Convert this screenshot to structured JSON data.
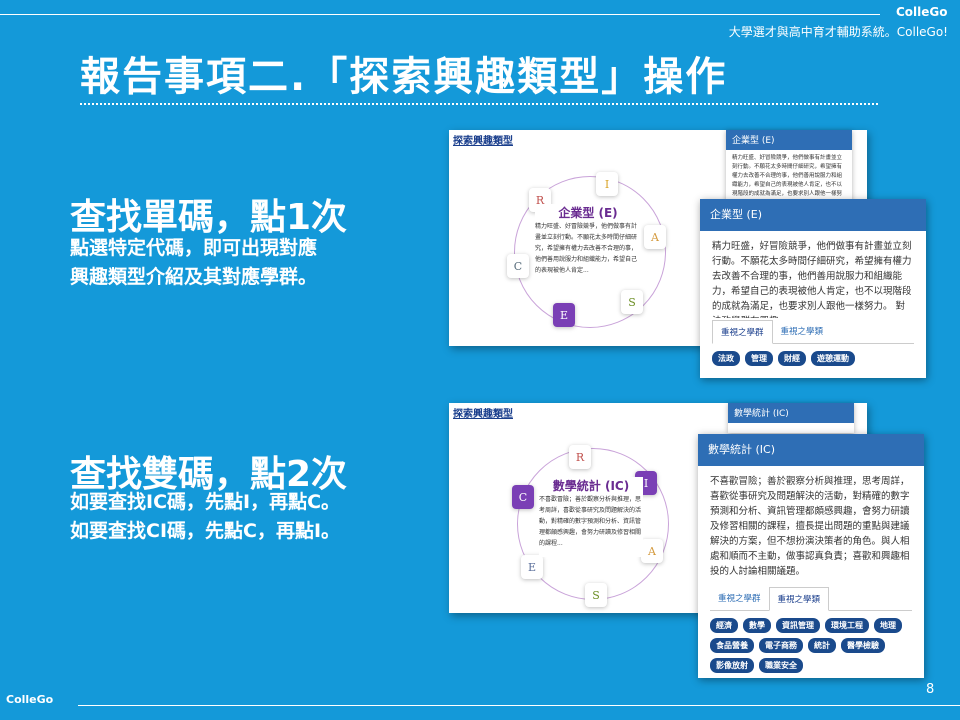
{
  "header": {
    "brand": "ColleGo",
    "subtitle": "大學選才與高中育才輔助系統。ColleGo!",
    "title": "報告事項二.「探索興趣類型」操作"
  },
  "section1": {
    "heading": "查找單碼，點1次",
    "line1": "點選特定代碼，即可出現對應",
    "line2": "興趣類型介紹及其對應學群。"
  },
  "section2": {
    "heading": "查找雙碼，點2次",
    "line1": "如要查找IC碼，先點I，再點C。",
    "line2": "如要查找CI碼，先點C，再點I。"
  },
  "shot1": {
    "tab": "探索興趣類型",
    "nodes": {
      "r": "R",
      "i": "I",
      "a": "A",
      "s": "S",
      "e": "E",
      "c": "C"
    },
    "center_title": "企業型 (E)",
    "center_text": "精力旺盛、好冒險競爭，他們做事有計畫並立刻行動。不願花太多時間仔細研究，希望擁有權力去改善不合理的事，他們善用說服力和組織能力，希望自己的表現被他人肯定...",
    "back_popup_title": "企業型 (E)",
    "back_popup_text": "精力旺盛、好冒險競爭，他們做事有計畫並立刻行動。不願花太多時間仔細研究，希望擁有權力去改善不合理的事，他們善用說服力和組織能力，希望自己的表現被他人肯定，也不以現階段的成就為滿足，也要求別人跟他一樣努力。",
    "popup_title": "企業型 (E)",
    "popup_text": "精力旺盛，好冒險競爭，他們做事有計畫並立刻行動。不願花太多時間仔細研究，希望擁有權力去改善不合理的事，他們善用說服力和組織能力，希望自己的表現被他人肯定，也不以現階段的成就為滿足，也要求別人跟他一樣努力。 對法政學群有興趣。",
    "tab_a": "重視之學群",
    "tab_b": "重視之學類",
    "chips": [
      "法政",
      "管理",
      "財經",
      "遊憩運動"
    ]
  },
  "shot2": {
    "tab": "探索興趣類型",
    "nodes": {
      "r": "R",
      "i": "I",
      "a": "A",
      "s": "S",
      "e": "E",
      "c": "C"
    },
    "center_title": "數學統計 (IC)",
    "center_text": "不喜歡冒險；善於觀察分析與推理，思考周詳，喜歡從事研究及問題解決的活動，對精確的數字預測和分析、資訊管理都頗感興趣，會努力研讀及修習相關的課程...",
    "back_popup_title": "數學統計 (IC)",
    "popup_title": "數學統計 (IC)",
    "popup_text": "不喜歡冒險；善於觀察分析與推理，思考周詳，喜歡從事研究及問題解決的活動，對精確的數字預測和分析、資訊管理都頗感興趣，會努力研讀及修習相關的課程，擅長提出問題的重點與建議解決的方案，但不想扮演決策者的角色。與人相處和順而不主動，做事認真負責；喜歡和興趣相投的人討論相關議題。",
    "tab_a": "重視之學群",
    "tab_b": "重視之學類",
    "chips": [
      "經濟",
      "數學",
      "資訊管理",
      "環境工程",
      "地理",
      "食品營養",
      "電子商務",
      "統計",
      "醫學檢驗",
      "影像放射",
      "職業安全"
    ]
  },
  "footer": {
    "brand": "ColleGo",
    "page": "8"
  }
}
